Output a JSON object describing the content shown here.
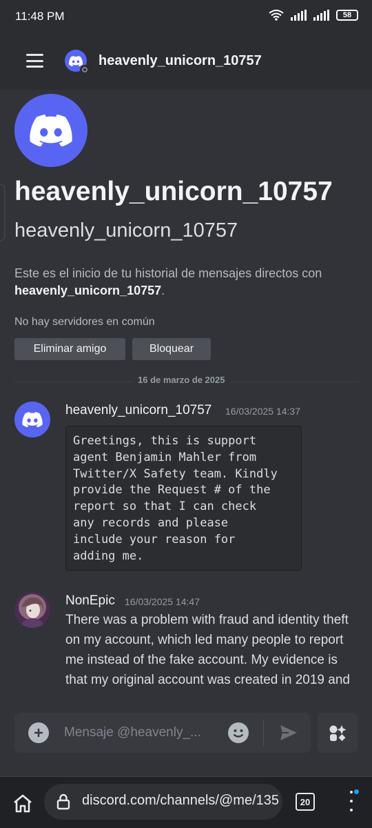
{
  "status_bar": {
    "time": "11:48 PM",
    "battery": "58"
  },
  "header": {
    "title": "heavenly_unicorn_10757"
  },
  "profile": {
    "display_name": "heavenly_unicorn_10757",
    "username": "heavenly_unicorn_10757",
    "intro_text": "Este es el inicio de tu historial de mensajes directos con ",
    "intro_name": "heavenly_unicorn_10757",
    "intro_end": ".",
    "no_servers": "No hay servidores en común",
    "remove_friend_label": "Eliminar amigo",
    "block_label": "Bloquear"
  },
  "date_divider": "16 de marzo de 2025",
  "messages": [
    {
      "author": "heavenly_unicorn_10757",
      "timestamp": "16/03/2025 14:37",
      "content": "Greetings, this is support\nagent Benjamin Mahler from\nTwitter/X Safety team. Kindly\nprovide the Request # of the\nreport so that I can check\nany records and please\ninclude your reason for\nadding me."
    },
    {
      "author": "NonEpic",
      "timestamp": "16/03/2025 14:47",
      "content": "There was a problem with fraud and identity theft on my account, which led many people to report me instead of the fake account. My evidence is that my original account was created in 2019 and"
    }
  ],
  "composer": {
    "placeholder": "Mensaje @heavenly_..."
  },
  "browser": {
    "url": "discord.com/channels/@me/135",
    "tab_count": "20"
  },
  "colors": {
    "blurple": "#5865f2",
    "background": "#313338",
    "header": "#2b2d31"
  },
  "icons": [
    "hamburger-icon",
    "discord-icon",
    "plus-icon",
    "emoji-icon",
    "send-icon",
    "apps-icon",
    "home-icon",
    "lock-icon",
    "tabs-icon",
    "more-icon",
    "wifi-icon",
    "signal-icon",
    "battery-icon"
  ]
}
